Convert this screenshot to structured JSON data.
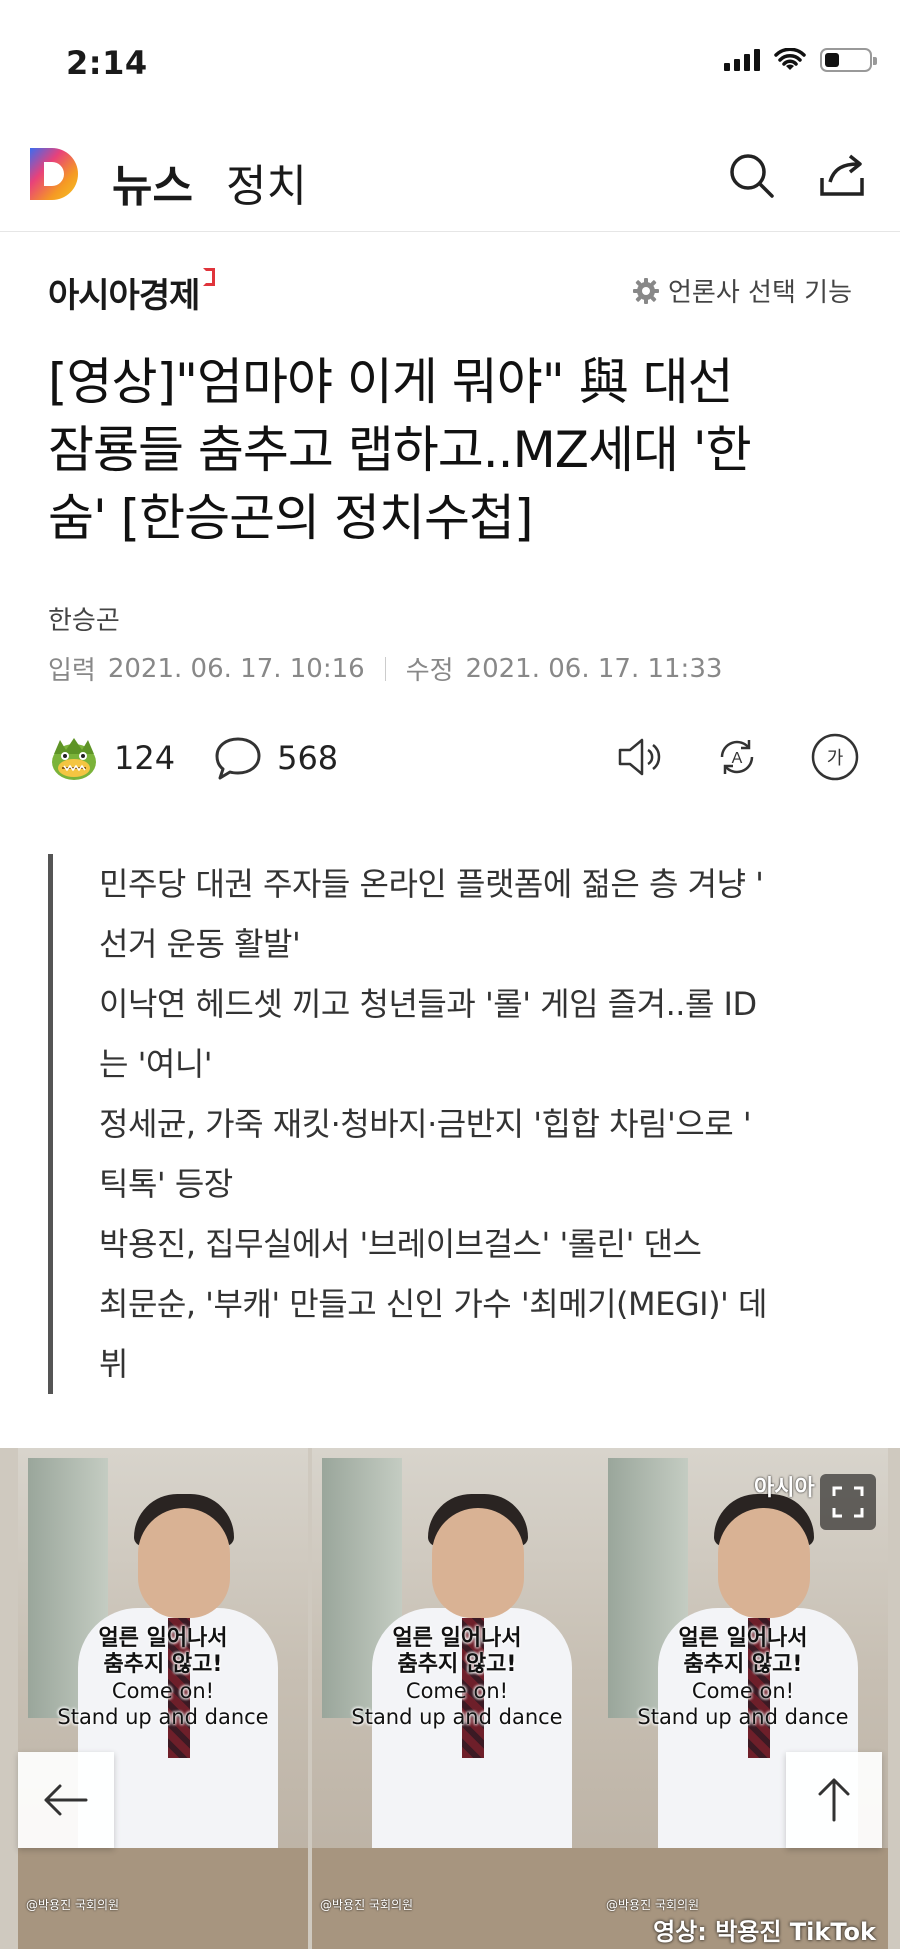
{
  "status_bar": {
    "time": "2:14"
  },
  "header": {
    "app_name": "뉴스",
    "section": "정치"
  },
  "press": {
    "name": "아시아경제",
    "select_label": "언론사 선택 기능"
  },
  "article": {
    "headline_lines": [
      "[영상]\"엄마야 이게 뭐야\" 與 대선",
      "잠룡들 춤추고 랩하고..MZ세대 '한",
      "숨' [한승곤의 정치수첩]"
    ],
    "author": "한승곤",
    "input_label": "입력",
    "input_date": "2021. 06. 17. 10:16",
    "edit_label": "수정",
    "edit_date": "2021. 06. 17. 11:33"
  },
  "actions": {
    "reaction_count": "124",
    "comment_count": "568",
    "font_button": "가"
  },
  "summary": [
    "민주당 대권 주자들 온라인 플랫폼에 젊은 층 겨냥 '",
    "선거 운동 활발'",
    "이낙연 헤드셋 끼고 청년들과 '롤' 게임 즐겨..롤 ID",
    "는 '여니'",
    "정세균, 가죽 재킷·청바지·금반지 '힙합 차림'으로 '",
    "틱톡' 등장",
    "박용진, 집무실에서 '브레이브걸스' '롤린' 댄스",
    "최문순, '부캐' 만들고 신인 가수 '최메기(MEGI)' 데",
    "뷔"
  ],
  "video": {
    "caption_ko_1": "얼른 일어나서",
    "caption_ko_2": "춤추지 않고!",
    "caption_en_1": "Come on!",
    "caption_en_2": "Stand up and dance",
    "panel_footer": "@박용진 국회의원",
    "watermark": "아시아",
    "credit": "영상: 박용진 TikTok"
  }
}
